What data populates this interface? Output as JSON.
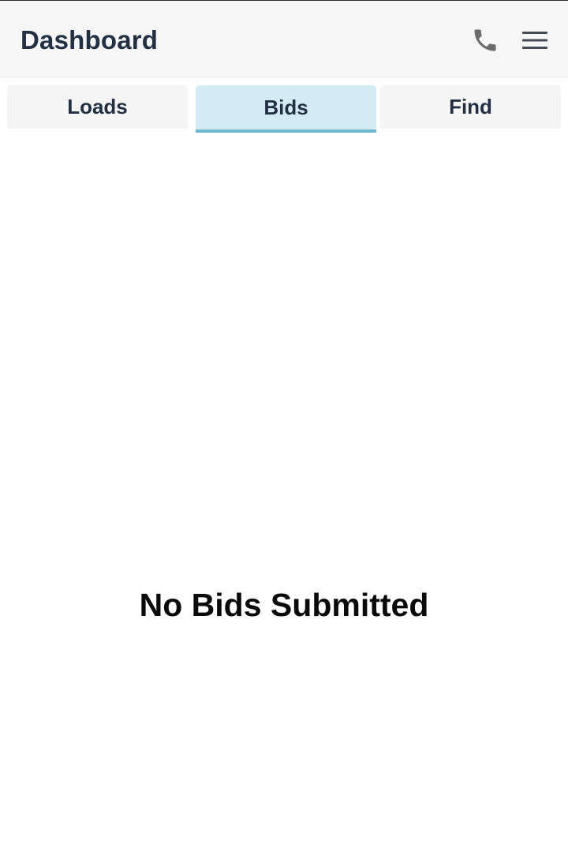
{
  "header": {
    "title": "Dashboard",
    "phone_icon": "phone-icon",
    "menu_icon": "hamburger-menu-icon"
  },
  "tabs": [
    {
      "label": "Loads",
      "active": false
    },
    {
      "label": "Bids",
      "active": true
    },
    {
      "label": "Find",
      "active": false
    }
  ],
  "main": {
    "empty_message": "No Bids Submitted"
  },
  "colors": {
    "header_bg": "#f6f6f6",
    "title_text": "#233044",
    "active_tab_bg": "#d3ebf3",
    "active_tab_underline": "#6fb8d2",
    "icon_gray": "#6b6b6b"
  }
}
